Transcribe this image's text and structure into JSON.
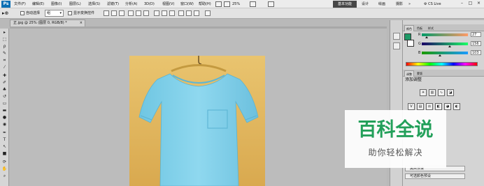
{
  "app": {
    "logo_text": "Ps"
  },
  "menu": {
    "items": [
      "文件(F)",
      "编辑(E)",
      "图像(I)",
      "图层(L)",
      "选择(S)",
      "滤镜(T)",
      "分析(A)",
      "3D(D)",
      "视图(V)",
      "窗口(W)",
      "帮助(H)"
    ],
    "zoom": "25%"
  },
  "workspace": {
    "active": "基本功能",
    "items": [
      "设计",
      "绘画",
      "摄影"
    ],
    "cs_live": "CS Live"
  },
  "window_controls": {
    "minimize": "–",
    "restore": "□",
    "close": "×"
  },
  "options_bar": {
    "tool_glyph": "▸⊕",
    "auto_select_label": "自动选择",
    "auto_select_value": "组",
    "show_transform_label": "显示变换控件"
  },
  "document": {
    "tab_title": "正.jpg @ 25% (图层 0, RGB/8) *",
    "close_glyph": "×"
  },
  "color_panel": {
    "tabs": [
      "颜色",
      "色板",
      "样式"
    ],
    "channels": [
      {
        "label": "R",
        "value": "27",
        "fraction": 0.11,
        "gradient": "linear-gradient(to right, #009a67, #ff9a67)"
      },
      {
        "label": "G",
        "value": "156",
        "fraction": 0.61,
        "gradient": "linear-gradient(to right, #1b0067, #1bff67)"
      },
      {
        "label": "B",
        "value": "103",
        "fraction": 0.4,
        "gradient": "linear-gradient(to right, #1b9a00, #1b9aff)"
      }
    ],
    "foreground": "#1e9a67",
    "background": "#ffffff"
  },
  "adjust_panel": {
    "tabs": [
      "调整",
      "蒙版"
    ],
    "title": "添加调整",
    "presets": [
      "黑白预设",
      "可选颜色预设"
    ]
  },
  "watermark": {
    "title": "百科全说",
    "subtitle": "助你轻松解决",
    "color": "#23a05a"
  }
}
